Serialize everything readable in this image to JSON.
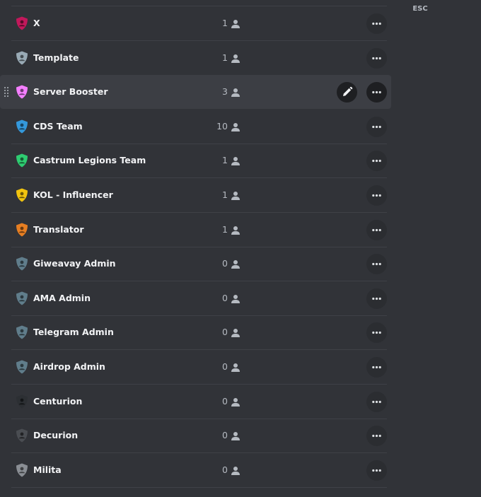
{
  "esc_label": "ESC",
  "roles": [
    {
      "name": "X",
      "members": "1",
      "color": "#c2185b"
    },
    {
      "name": "Template",
      "members": "1",
      "color": "#99aab5"
    },
    {
      "name": "Server Booster",
      "members": "3",
      "color": "#f47fff",
      "hovered": true
    },
    {
      "name": "CDS Team",
      "members": "10",
      "color": "#3498db"
    },
    {
      "name": "Castrum Legions Team",
      "members": "1",
      "color": "#2ecc71"
    },
    {
      "name": "KOL - Influencer",
      "members": "1",
      "color": "#f1c40f"
    },
    {
      "name": "Translator",
      "members": "1",
      "color": "#e67e22"
    },
    {
      "name": "Giweavay Admin",
      "members": "0",
      "color": "#607d8b"
    },
    {
      "name": "AMA Admin",
      "members": "0",
      "color": "#607d8b"
    },
    {
      "name": "Telegram Admin",
      "members": "0",
      "color": "#607d8b"
    },
    {
      "name": "Airdrop Admin",
      "members": "0",
      "color": "#607d8b"
    },
    {
      "name": "Centurion",
      "members": "0",
      "color": "#2c2f33"
    },
    {
      "name": "Decurion",
      "members": "0",
      "color": "#4a4d52"
    },
    {
      "name": "Milita",
      "members": "0",
      "color": "#8a8e94"
    }
  ],
  "icons": {
    "role": "shield-icon",
    "members": "person-icon",
    "edit": "pencil-icon",
    "more": "more-dots-icon",
    "drag": "drag-handle-icon",
    "close": "close-circle-icon"
  },
  "colors": {
    "background": "#313338",
    "hover_row": "#3c3e44",
    "button_bg": "#2b2d31",
    "button_bg_active": "#1e1f22",
    "text": "#f2f3f5",
    "muted": "#b5bac1"
  }
}
